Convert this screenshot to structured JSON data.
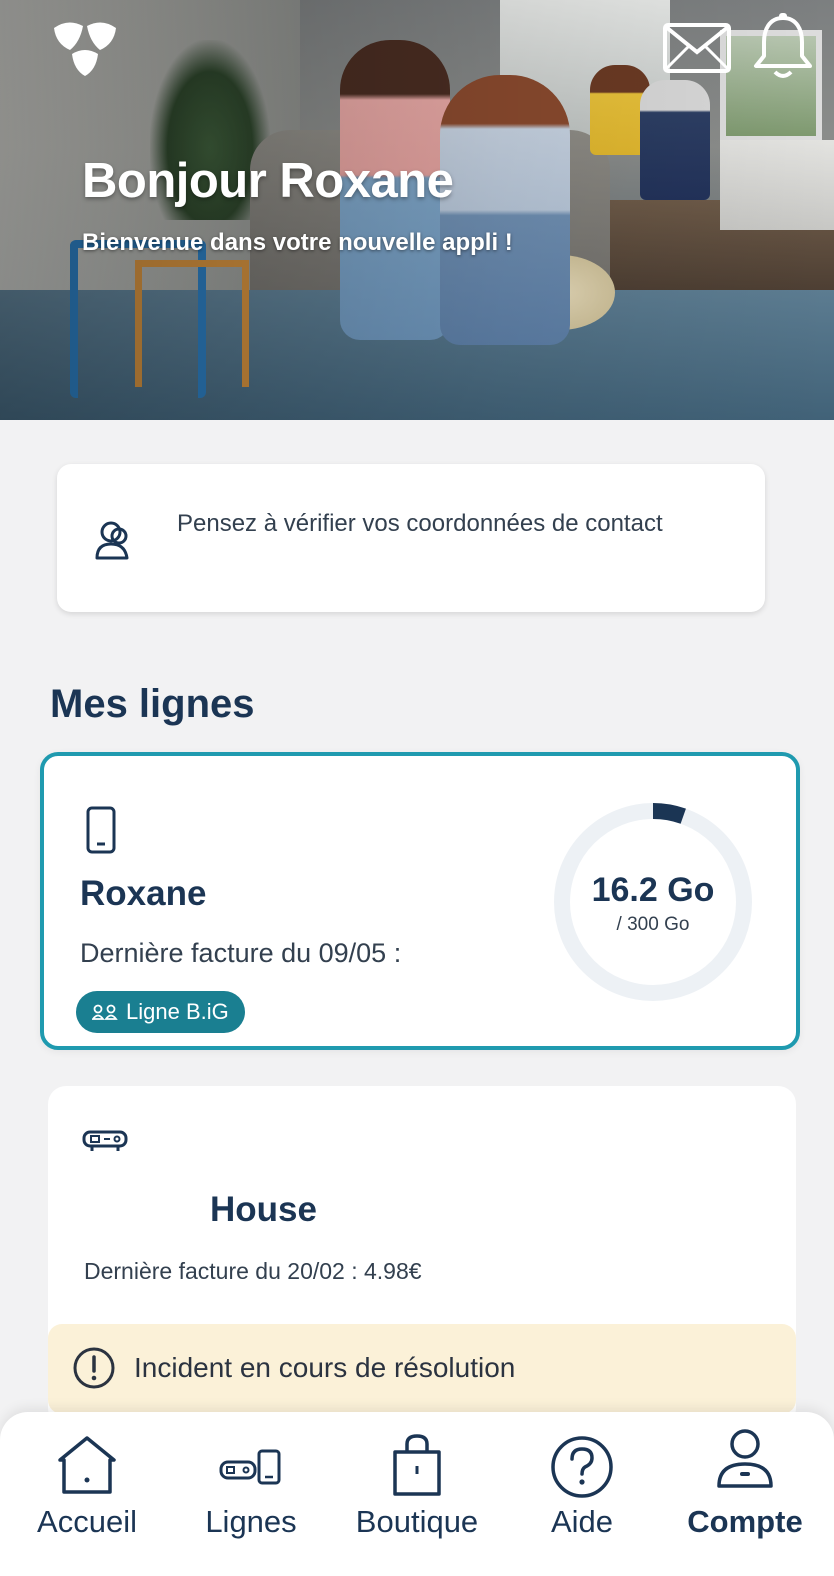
{
  "hero": {
    "title": "Bonjour Roxane",
    "subtitle": "Bienvenue dans votre nouvelle appli !",
    "icons": [
      "mail-icon",
      "bell-icon",
      "brand-logo"
    ]
  },
  "notice": {
    "icon": "contact-icon",
    "text": "Pensez à vérifier vos coordonnées de contact"
  },
  "lines": {
    "title": "Mes lignes",
    "roxane": {
      "icon": "phone-icon",
      "name": "Roxane",
      "invoice": "Dernière facture du 09/05 :",
      "badge": "Ligne B.iG",
      "usage_value": "16.2 Go",
      "usage_total": "/ 300 Go",
      "usage_fraction": 0.054
    },
    "house": {
      "icon": "box-icon",
      "name": "House",
      "invoice": "Dernière facture du 20/02 : 4.98€",
      "alert": "Incident en cours de résolution"
    }
  },
  "tabbar": {
    "items": [
      {
        "label": "Accueil",
        "icon": "home-icon"
      },
      {
        "label": "Lignes",
        "icon": "lines-icon"
      },
      {
        "label": "Boutique",
        "icon": "shopping-bag-icon"
      },
      {
        "label": "Aide",
        "icon": "help-icon"
      },
      {
        "label": "Compte",
        "icon": "account-icon",
        "active": true
      }
    ]
  },
  "colors": {
    "accent": "#1f9aaf",
    "badge": "#1a7f91",
    "text_dark": "#1b3554",
    "alert_bg": "#fbf1d8",
    "gauge_track": "#edf1f5",
    "gauge_fill": "#1b3554"
  }
}
